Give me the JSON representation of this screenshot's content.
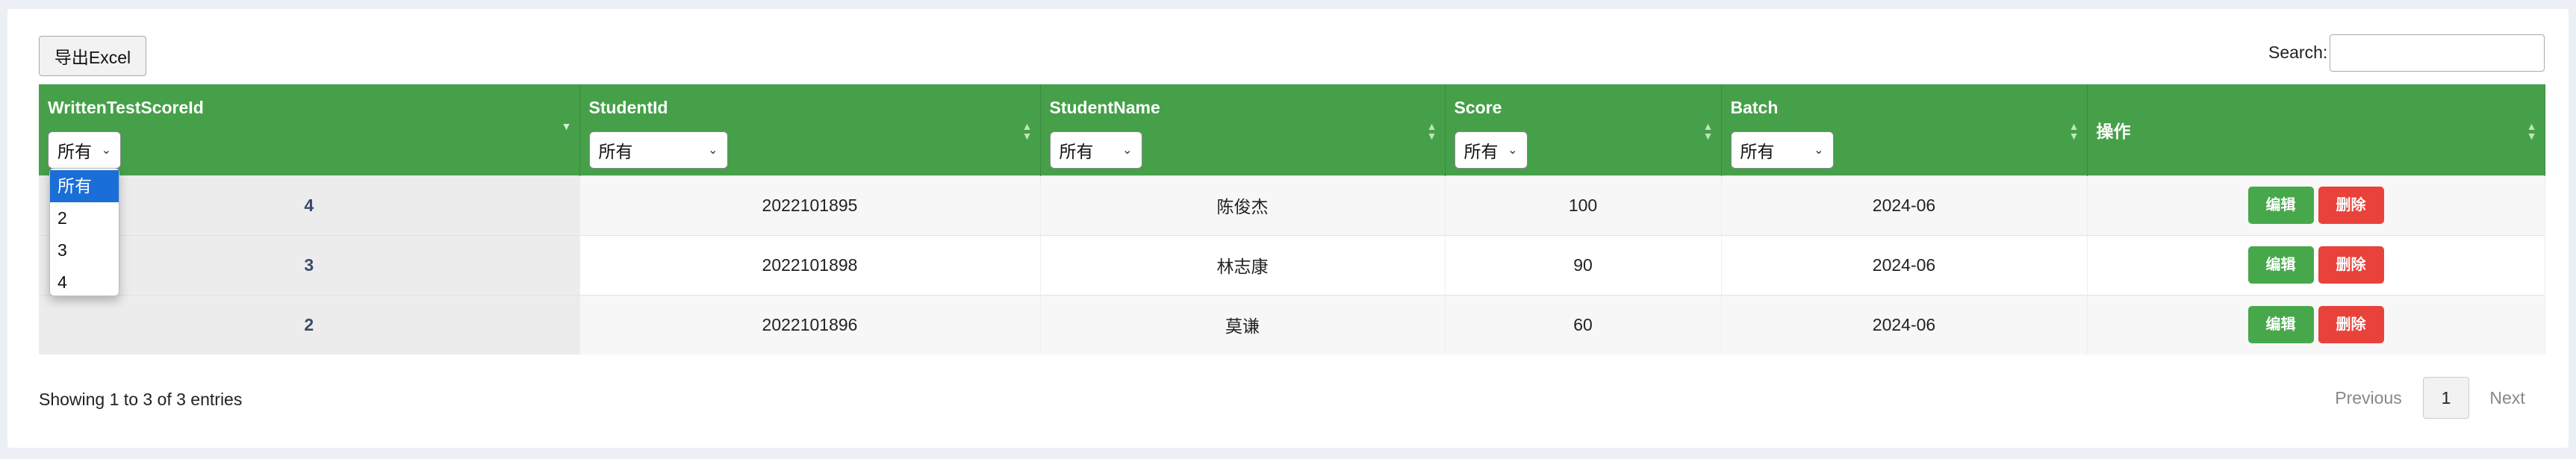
{
  "toolbar": {
    "export_label": "导出Excel"
  },
  "search": {
    "label": "Search:",
    "value": "",
    "placeholder": ""
  },
  "table": {
    "columns": [
      {
        "label": "WrittenTestScoreId",
        "filter": "所有"
      },
      {
        "label": "StudentId",
        "filter": "所有"
      },
      {
        "label": "StudentName",
        "filter": "所有"
      },
      {
        "label": "Score",
        "filter": "所有"
      },
      {
        "label": "Batch",
        "filter": "所有"
      },
      {
        "label": "操作"
      }
    ],
    "rows": [
      {
        "id": "4",
        "student_id": "2022101895",
        "name": "陈俊杰",
        "score": "100",
        "batch": "2024-06"
      },
      {
        "id": "3",
        "student_id": "2022101898",
        "name": "林志康",
        "score": "90",
        "batch": "2024-06"
      },
      {
        "id": "2",
        "student_id": "2022101896",
        "name": "莫谦",
        "score": "60",
        "batch": "2024-06"
      }
    ],
    "edit_label": "编辑",
    "delete_label": "删除"
  },
  "dropdown": {
    "options": [
      "所有",
      "2",
      "3",
      "4"
    ],
    "selected": "所有"
  },
  "footer": {
    "info": "Showing 1 to 3 of 3 entries",
    "previous": "Previous",
    "page": "1",
    "next": "Next"
  },
  "colors": {
    "header": "#46a049",
    "edit": "#47a84b",
    "delete": "#e8423a",
    "dropdown_selected": "#1a6ed8"
  }
}
